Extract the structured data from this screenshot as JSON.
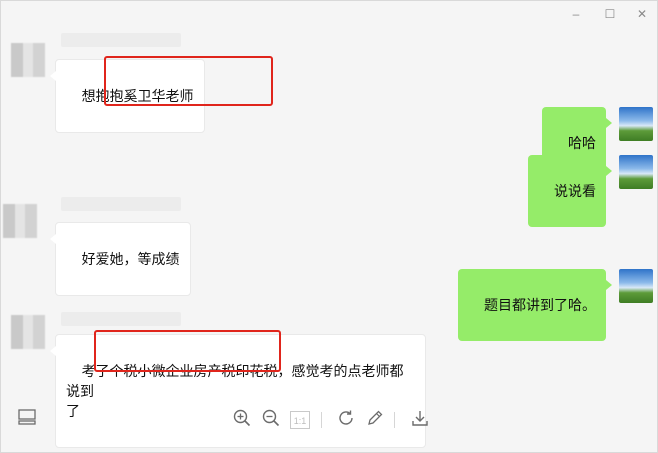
{
  "window": {
    "controls": {
      "minimize": "–",
      "maximize": "☐",
      "close": "✕"
    }
  },
  "messages": [
    {
      "side": "left",
      "text": "想抱抱奚卫华老师",
      "highlighted": true
    },
    {
      "side": "right",
      "text": "哈哈"
    },
    {
      "side": "right",
      "text": "说说看"
    },
    {
      "side": "left",
      "text": "好爱她，等成绩"
    },
    {
      "side": "right",
      "text": "题目都讲到了哈。"
    },
    {
      "side": "left",
      "text": "考了个税小微企业房产税印花税，感觉考的点老师都说到\n了",
      "highlighted": true
    }
  ],
  "toolbar": {
    "icons": [
      "sidebar-icon",
      "zoom-in-icon",
      "zoom-out-icon",
      "actual-size-icon",
      "rotate-icon",
      "edit-icon",
      "download-icon"
    ],
    "actual_size_label": "1:1"
  },
  "colors": {
    "background": "#f5f5f5",
    "bubble_self": "#95ec69",
    "bubble_other": "#ffffff",
    "highlight": "#e0251c"
  }
}
